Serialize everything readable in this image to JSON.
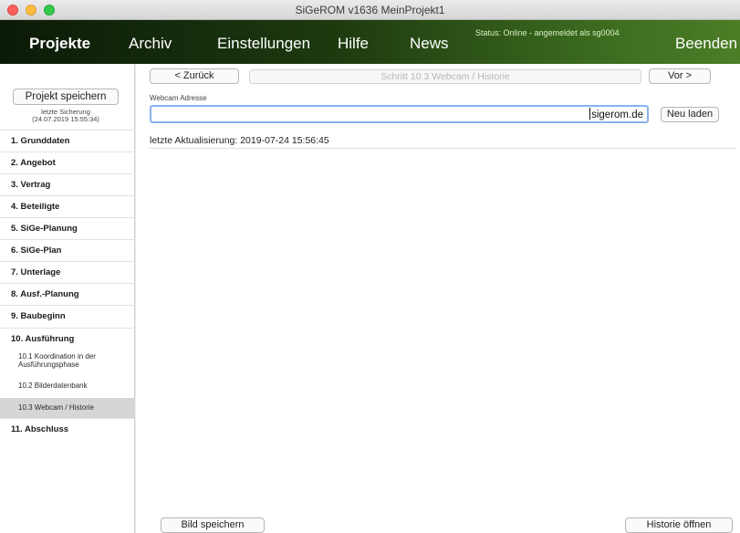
{
  "window": {
    "title": "SiGeROM  v1636   MeinProjekt1"
  },
  "menu": {
    "items": [
      "Projekte",
      "Archiv",
      "Einstellungen",
      "Hilfe",
      "News",
      "Beenden"
    ],
    "status": "Status: Online - angemeldet als sg0004"
  },
  "sidebar": {
    "save_button": "Projekt speichern",
    "last_save_label": "letzte Sicherung",
    "last_save_time": "(24.07.2019 15:55:34)",
    "items": [
      "1.  Grunddaten",
      "2.  Angebot",
      "3.  Vertrag",
      "4.  Beteiligte",
      "5.  SiGe-Planung",
      "6.  SiGe-Plan",
      "7.  Unterlage",
      "8.  Ausf.-Planung",
      "9.  Baubeginn",
      "10. Ausführung"
    ],
    "subitems": [
      "10.1 Koordination in der",
      "Ausführungsphase",
      "10.2 Bilderdatenbank",
      "10.3 Webcam / Historie"
    ],
    "last_item": "11. Abschluss"
  },
  "toolbar": {
    "back": "< Zurück",
    "step": "Schritt 10.3  Webcam / Historie",
    "next": "Vor >"
  },
  "webcam": {
    "label": "Webcam Adresse",
    "value": "sigerom.de",
    "reload": "Neu laden",
    "updated": "letzte Aktualisierung: 2019-07-24 15:56:45"
  },
  "footer": {
    "save_image": "Bild speichern",
    "open_history": "Historie öffnen"
  }
}
